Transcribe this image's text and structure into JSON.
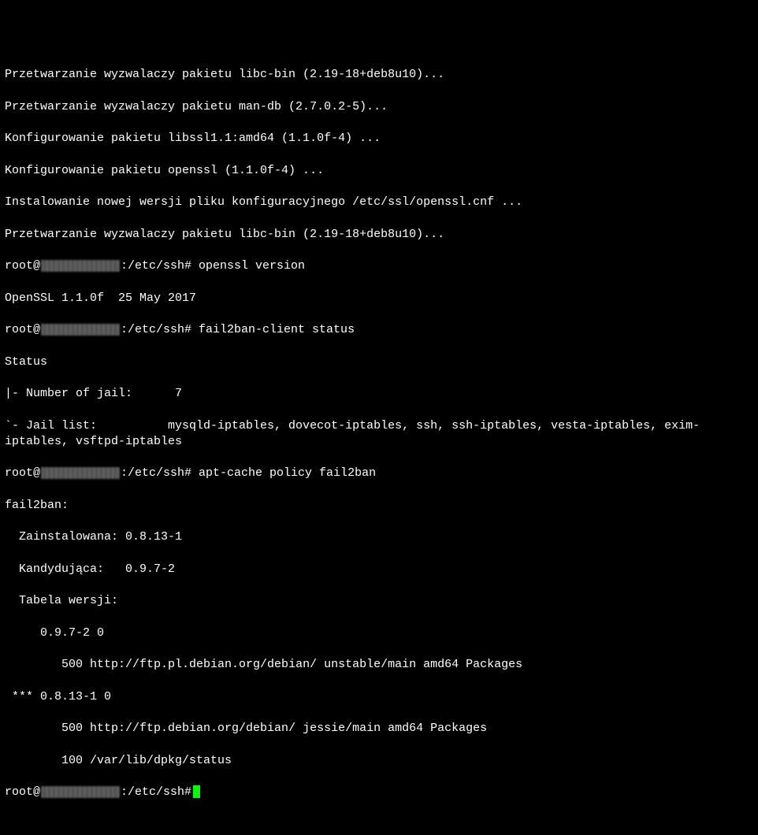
{
  "output": {
    "trigger_libcbin1": "Przetwarzanie wyzwalaczy pakietu libc-bin (2.19-18+deb8u10)...",
    "trigger_mandb": "Przetwarzanie wyzwalaczy pakietu man-db (2.7.0.2-5)...",
    "config_libssl": "Konfigurowanie pakietu libssl1.1:amd64 (1.1.0f-4) ...",
    "config_openssl": "Konfigurowanie pakietu openssl (1.1.0f-4) ...",
    "install_conf": "Instalowanie nowej wersji pliku konfiguracyjnego /etc/ssl/openssl.cnf ...",
    "trigger_libcbin2": "Przetwarzanie wyzwalaczy pakietu libc-bin (2.19-18+deb8u10)..."
  },
  "prompts": {
    "user_at": "root@",
    "path_prompt": ":/etc/ssh#",
    "cmd_openssl": " openssl version",
    "cmd_fail2ban": " fail2ban-client status",
    "cmd_aptcache": " apt-cache policy fail2ban"
  },
  "openssl_version": "OpenSSL 1.1.0f  25 May 2017",
  "fail2ban_status": {
    "header": "Status",
    "number_line": "|- Number of jail:      7",
    "jail_list": "`- Jail list:          mysqld-iptables, dovecot-iptables, ssh, ssh-iptables, vesta-iptables, exim-iptables, vsftpd-iptables"
  },
  "apt_policy": {
    "pkg": "fail2ban:",
    "installed": "  Zainstalowana: 0.8.13-1",
    "candidate": "  Kandydująca:   0.9.7-2",
    "table_header": "  Tabela wersji:",
    "v1": "     0.9.7-2 0",
    "v1_src": "        500 http://ftp.pl.debian.org/debian/ unstable/main amd64 Packages",
    "v2": " *** 0.8.13-1 0",
    "v2_src": "        500 http://ftp.debian.org/debian/ jessie/main amd64 Packages",
    "v2_status": "        100 /var/lib/dpkg/status"
  }
}
